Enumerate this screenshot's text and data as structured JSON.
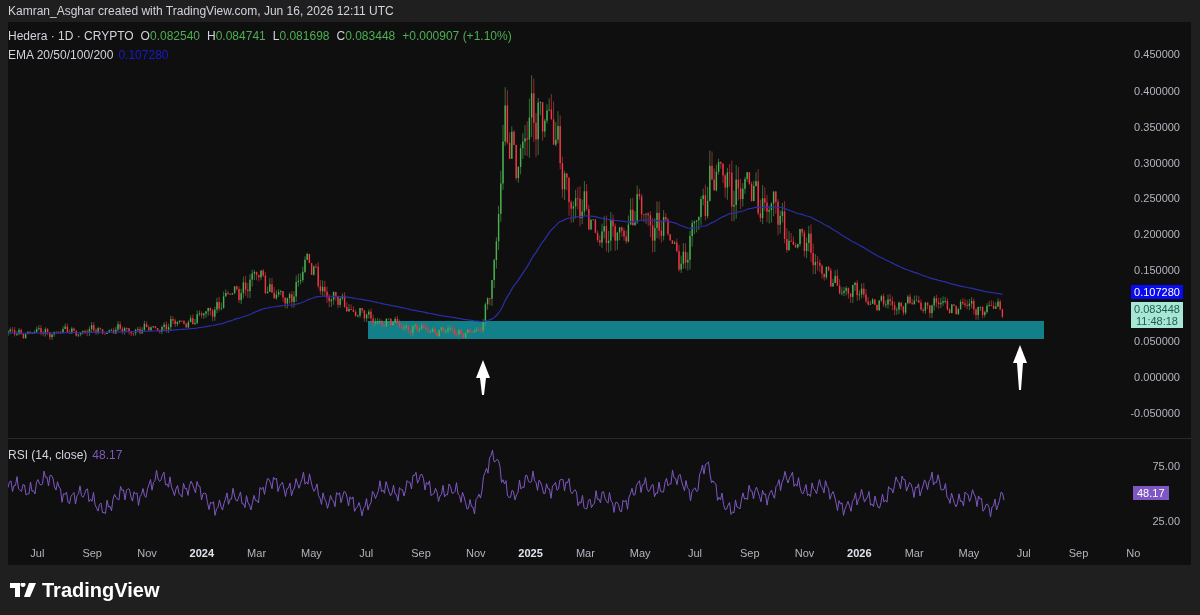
{
  "attribution": "Kamran_Asghar created with TradingView.com, Jun 16, 2026 12:11 UTC",
  "legend": {
    "symbol": "Hedera · 1D · CRYPTO",
    "values": [
      {
        "label": "O",
        "value": "0.082540"
      },
      {
        "label": "H",
        "value": "0.084741"
      },
      {
        "label": "L",
        "value": "0.081698"
      },
      {
        "label": "C",
        "value": "0.083448"
      }
    ],
    "change": "+0.000907 (+1.10%)"
  },
  "indicator": {
    "name": "EMA 20/50/100/200",
    "value": "0.107280"
  },
  "price_axis": [
    "0.450000",
    "0.400000",
    "0.350000",
    "0.300000",
    "0.250000",
    "0.200000",
    "0.150000",
    "0.050000",
    "0.000000",
    "-0.050000"
  ],
  "price_labels": [
    {
      "kind": "ema",
      "lines": [
        "0.107280"
      ],
      "color": "#0a0af0"
    },
    {
      "kind": "last",
      "lines": [
        "0.083448",
        "11:48:18"
      ],
      "color": "#a8e6d6"
    }
  ],
  "rsi": {
    "title": "RSI (14, close)",
    "value": "48.17",
    "ticks": [
      "75.00",
      "25.00"
    ],
    "value_label": "48.17"
  },
  "time_axis": [
    {
      "label": "Jul",
      "bold": false
    },
    {
      "label": "Sep",
      "bold": false
    },
    {
      "label": "Nov",
      "bold": false
    },
    {
      "label": "2024",
      "bold": true
    },
    {
      "label": "Mar",
      "bold": false
    },
    {
      "label": "May",
      "bold": false
    },
    {
      "label": "Jul",
      "bold": false
    },
    {
      "label": "Sep",
      "bold": false
    },
    {
      "label": "Nov",
      "bold": false
    },
    {
      "label": "2025",
      "bold": true
    },
    {
      "label": "Mar",
      "bold": false
    },
    {
      "label": "May",
      "bold": false
    },
    {
      "label": "Jul",
      "bold": false
    },
    {
      "label": "Sep",
      "bold": false
    },
    {
      "label": "Nov",
      "bold": false
    },
    {
      "label": "2026",
      "bold": true
    },
    {
      "label": "Mar",
      "bold": false
    },
    {
      "label": "May",
      "bold": false
    },
    {
      "label": "Jul",
      "bold": false
    },
    {
      "label": "Sep",
      "bold": false
    },
    {
      "label": "No",
      "bold": false
    }
  ],
  "footer": {
    "brand": "TradingView"
  }
}
